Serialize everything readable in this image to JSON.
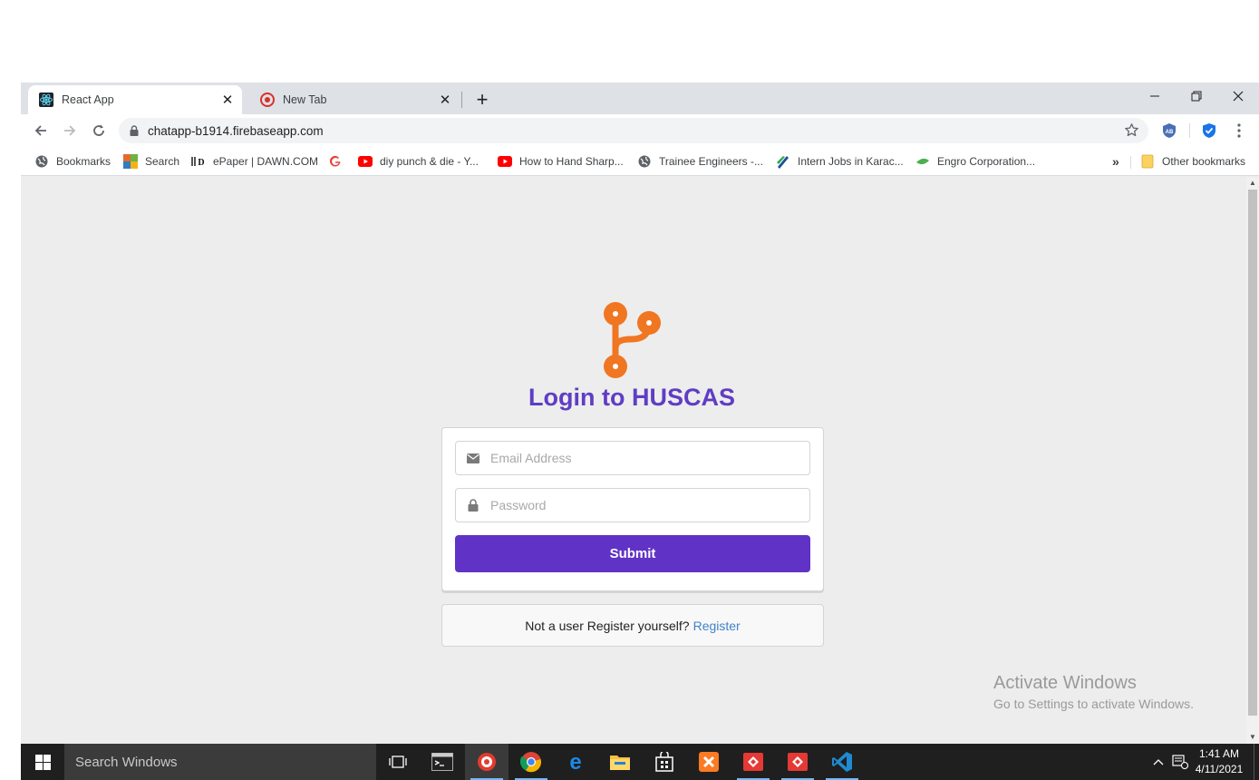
{
  "browser": {
    "tabs": [
      {
        "title": "React App",
        "icon": "react-icon"
      },
      {
        "title": "New Tab",
        "icon": "tab-favicon"
      }
    ],
    "address": "chatapp-b1914.firebaseapp.com",
    "bookmarks": [
      {
        "label": "Bookmarks"
      },
      {
        "label": "Search"
      },
      {
        "label": "ePaper | DAWN.COM"
      },
      {
        "label": ""
      },
      {
        "label": "diy punch & die - Y..."
      },
      {
        "label": "How to Hand Sharp..."
      },
      {
        "label": "Trainee Engineers -..."
      },
      {
        "label": "Intern Jobs in Karac..."
      },
      {
        "label": "Engro Corporation..."
      }
    ],
    "overflow_label": "»",
    "other_bookmarks": "Other bookmarks"
  },
  "login": {
    "heading": "Login to HUSCAS",
    "email_placeholder": "Email Address",
    "password_placeholder": "Password",
    "submit_label": "Submit",
    "register_prompt": "Not a user Register yourself?",
    "register_link": "Register",
    "accent_color": "#6033c6",
    "logo_color": "#f07622"
  },
  "watermark": {
    "line1": "Activate Windows",
    "line2": "Go to Settings to activate Windows."
  },
  "taskbar": {
    "search_placeholder": "Search Windows",
    "time": "1:41 AM",
    "date": "4/11/2021"
  }
}
